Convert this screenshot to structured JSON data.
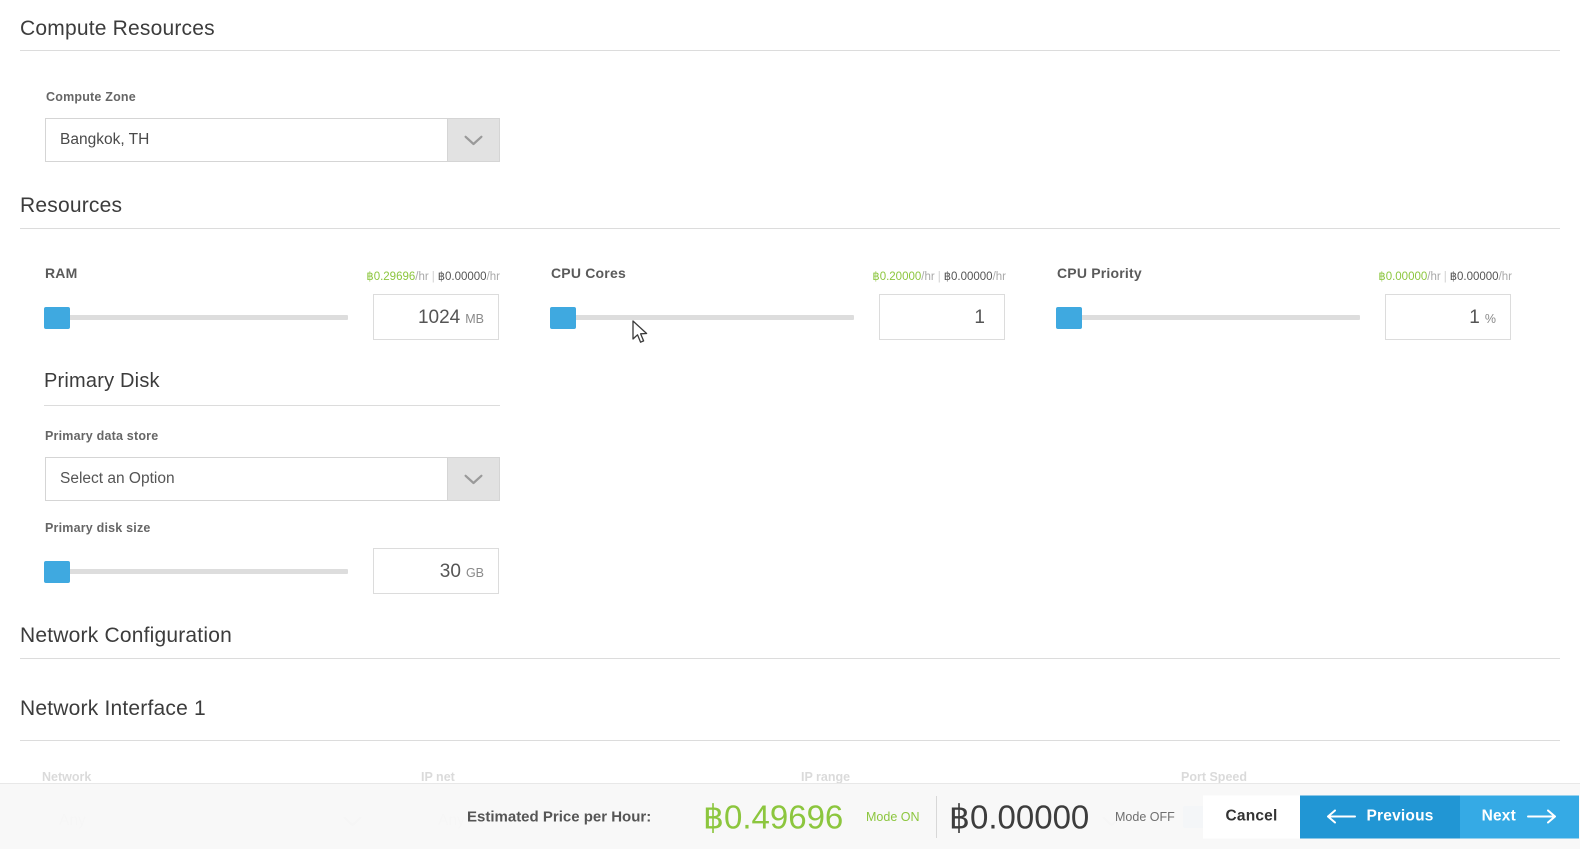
{
  "sections": {
    "compute_resources": "Compute Resources",
    "resources": "Resources",
    "primary_disk": "Primary Disk",
    "network_configuration": "Network Configuration",
    "network_interface_1": "Network Interface 1"
  },
  "compute_zone": {
    "label": "Compute Zone",
    "value": "Bangkok, TH",
    "icon": "chevron-down-icon"
  },
  "resources": [
    {
      "name": "ram",
      "title": "RAM",
      "price_green": "฿0.29696",
      "price_green_unit": "/hr",
      "price_dark": "฿0.00000",
      "price_dark_unit": "/hr",
      "value": "1024",
      "unit": "MB",
      "slider_percent": 2
    },
    {
      "name": "cpu-cores",
      "title": "CPU Cores",
      "price_green": "฿0.20000",
      "price_green_unit": "/hr",
      "price_dark": "฿0.00000",
      "price_dark_unit": "/hr",
      "value": "1",
      "unit": "",
      "slider_percent": 2
    },
    {
      "name": "cpu-priority",
      "title": "CPU Priority",
      "price_green": "฿0.00000",
      "price_green_unit": "/hr",
      "price_dark": "฿0.00000",
      "price_dark_unit": "/hr",
      "value": "1",
      "unit": "%",
      "slider_percent": 2
    }
  ],
  "primary_disk": {
    "data_store_label": "Primary data store",
    "data_store_value": "Select an Option",
    "disk_size_label": "Primary disk size",
    "disk_size_value": "30",
    "disk_size_unit": "GB",
    "slider_percent": 2
  },
  "network_interface": {
    "network_label": "Network",
    "network_value": "Any",
    "ip_net_label": "IP net",
    "ip_net_value": "Any",
    "ip_range_label": "IP range",
    "ip_range_value": "Any",
    "port_speed_label": "Port Speed"
  },
  "footer": {
    "estimated_label": "Estimated Price per Hour:",
    "price_on": "฿0.49696",
    "mode_on": "Mode ON",
    "price_off": "฿0.00000",
    "mode_off": "Mode OFF",
    "cancel": "Cancel",
    "previous": "Previous",
    "next": "Next"
  },
  "colors": {
    "accent_blue": "#3fa9e0",
    "button_blue": "#2196d4",
    "next_blue": "#35aae5",
    "price_green": "#8cc63e"
  }
}
